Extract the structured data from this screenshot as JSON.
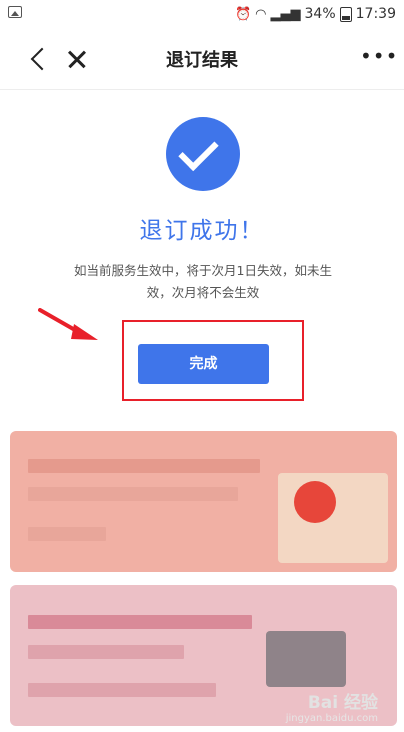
{
  "status_bar": {
    "battery_pct": "34%",
    "time": "17:39"
  },
  "navbar": {
    "title": "退订结果",
    "more_label": "•••"
  },
  "result": {
    "title": "退订成功！",
    "description": "如当前服务生效中，将于次月1日失效，如未生效，次月将不会生效"
  },
  "actions": {
    "done_label": "完成"
  },
  "watermark": {
    "main": "Bai 经验",
    "sub": "jingyan.baidu.com"
  },
  "colors": {
    "accent": "#3f75ea",
    "highlight": "#e8202a"
  }
}
